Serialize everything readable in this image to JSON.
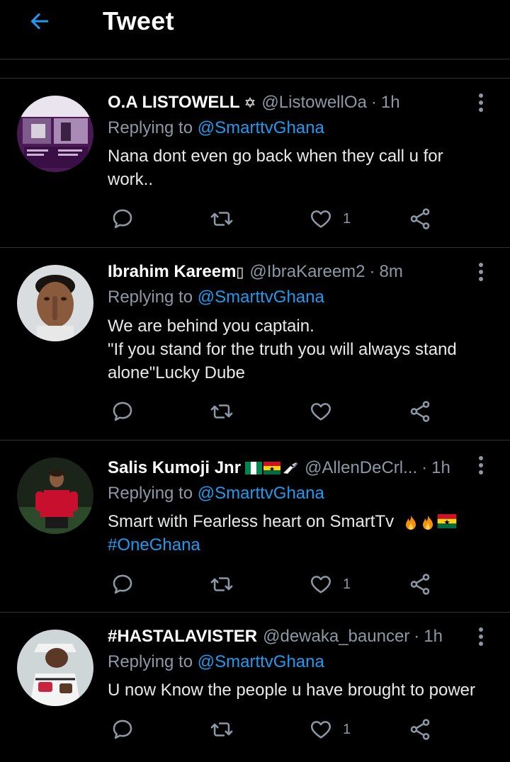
{
  "header": {
    "title": "Tweet"
  },
  "tweets": [
    {
      "name": "O.A LISTOWELL",
      "name_suffix": "✡",
      "handle": "@ListowellOa",
      "time": "1h",
      "replying_prefix": "Replying to ",
      "replying_to": "@SmarttvGhana",
      "text": "Nana dont even go back when they call u for work..",
      "like_count": "1"
    },
    {
      "name": "Ibrahim Kareem",
      "name_suffix": "▯",
      "handle": "@IbraKareem2",
      "time": "8m",
      "replying_prefix": "Replying to ",
      "replying_to": "@SmarttvGhana",
      "text_lines": [
        "We are behind you captain.",
        "\"If you stand for the truth you will always stand alone\"Lucky Dube"
      ],
      "like_count": ""
    },
    {
      "name": "Salis Kumoji Jnr",
      "handle": "@AllenDeCrl...",
      "time": "1h",
      "replying_prefix": "Replying to ",
      "replying_to": "@SmarttvGhana",
      "text": "Smart with Fearless heart on SmartTv",
      "hashtag": "#OneGhana",
      "like_count": "1"
    },
    {
      "name": "#HASTALAVISTER",
      "handle": "@dewaka_bauncer",
      "time": "1h",
      "replying_prefix": "Replying to ",
      "replying_to": "@SmarttvGhana",
      "text": "U now Know the people u have brought to power",
      "like_count": "1"
    }
  ],
  "colors": {
    "accent": "#1d9bf0",
    "muted": "#8b98a5",
    "divider": "#2f3336"
  }
}
